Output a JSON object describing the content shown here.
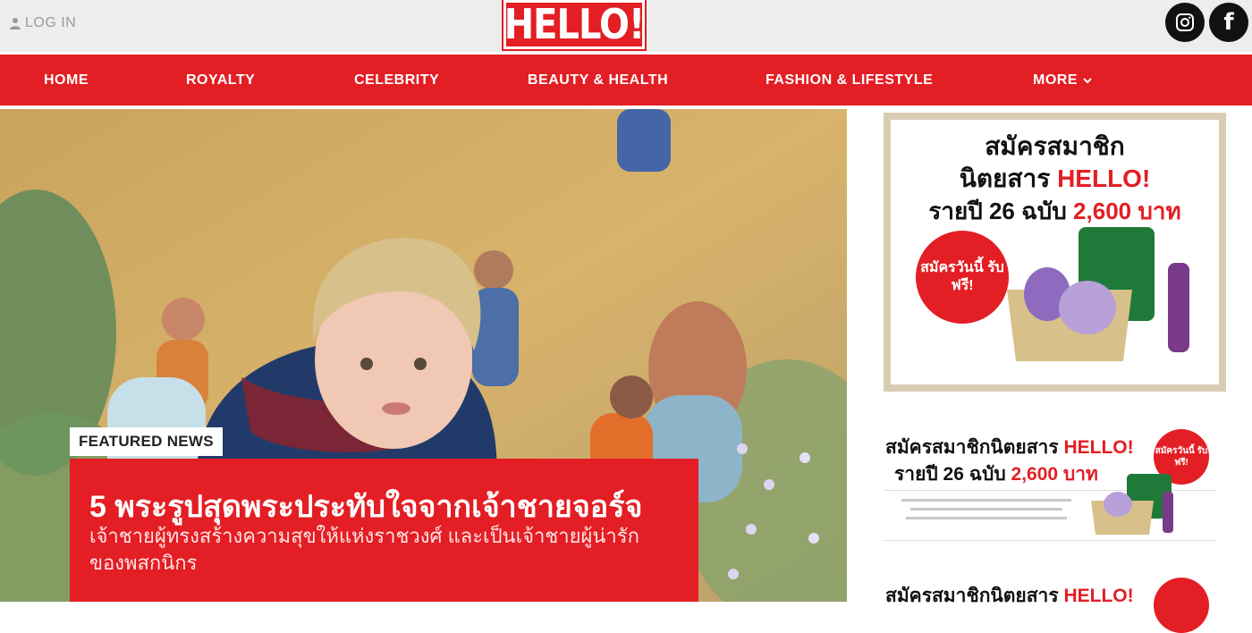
{
  "header": {
    "login_label": "LOG IN",
    "logo_text": "HELLO!",
    "social": [
      {
        "name": "instagram-icon"
      },
      {
        "name": "facebook-icon",
        "glyph": "f"
      }
    ]
  },
  "nav": {
    "items": [
      {
        "label": "HOME"
      },
      {
        "label": "ROYALTY"
      },
      {
        "label": "CELEBRITY"
      },
      {
        "label": "BEAUTY & HEALTH"
      },
      {
        "label": "FASHION & LIFESTYLE"
      },
      {
        "label": "MORE"
      }
    ]
  },
  "featured": {
    "tag": "FEATURED NEWS",
    "headline": "5 พระรูปสุดพระประทับใจจากเจ้าชายจอร์จ",
    "subheadline": "เจ้าชายผู้ทรงสร้างความสุขให้แห่งราชวงศ์ และเป็นเจ้าชายผู้น่ารักของพสกนิกร"
  },
  "ads": {
    "subscribe": {
      "line1": "สมัครสมาชิก",
      "line2_prefix": "นิตยสาร",
      "line2_brand": "HELLO!",
      "line3_prefix": "รายปี 26 ฉบับ",
      "line3_price": "2,600 บาท",
      "badge": "สมัครวันนี้ รับฟรี!"
    },
    "subscribe_small": {
      "line1_prefix": "สมัครสมาชิกนิตยสาร",
      "line1_brand": "HELLO!",
      "line2_prefix": "รายปี 26 ฉบับ",
      "line2_price": "2,600 บาท",
      "badge": "สมัครวันนี้ รับฟรี!"
    },
    "subscribe_small_2": {
      "line1_prefix": "สมัครสมาชิกนิตยสาร",
      "line1_brand": "HELLO!"
    }
  },
  "colors": {
    "brand_red": "#e31e24",
    "topbar_bg": "#ededed"
  }
}
